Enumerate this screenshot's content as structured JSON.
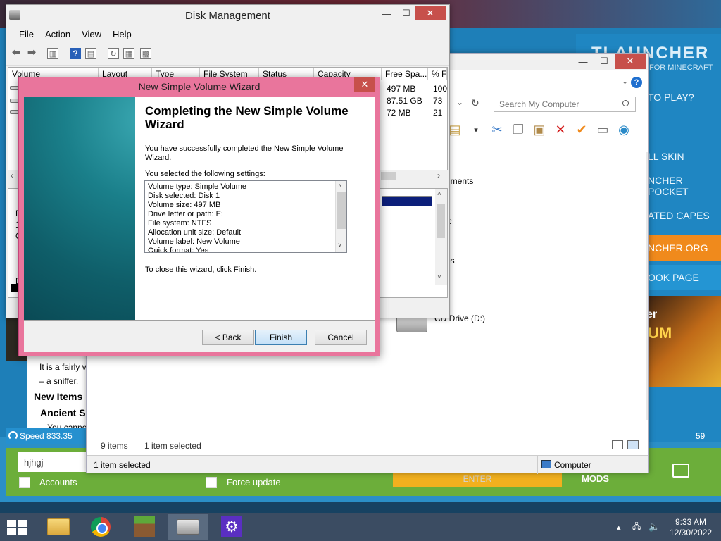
{
  "launcher": {
    "brand": "TLAUNCHER",
    "brand_sub": "FOR MINECRAFT",
    "menu_items": [
      "TO PLAY?",
      "",
      "LL SKIN",
      "NCHER POCKET",
      "ATED CAPES",
      "NCHER.ORG",
      "OOK PAGE"
    ],
    "promo_text": "UM",
    "promo_text_top": "er",
    "right_number": "59",
    "speed": "Speed 833.35",
    "nickname_value": "hjhgj",
    "accounts_label": "Accounts",
    "force_update_label": "Force update",
    "enter_button": "ENTER",
    "mods_logo": "MODS",
    "article": {
      "line1": "It is a fairly v",
      "line2": "– a sniffer.",
      "heading1": "New Items",
      "heading2": "Ancient Se",
      "line3": "- You cannot"
    }
  },
  "explorer": {
    "search_placeholder": "Search My Computer",
    "items": [
      {
        "label": "uments"
      },
      {
        "label": "ic"
      },
      {
        "label": "os"
      },
      {
        "label": "CD Drive (D:)"
      }
    ],
    "status_count": "9 items",
    "status_selected": "1 item selected",
    "bottom_selected": "1 item selected",
    "bottom_location": "Computer",
    "help_glyph": "?"
  },
  "disk_mgmt": {
    "title": "Disk Management",
    "menu": [
      "File",
      "Action",
      "View",
      "Help"
    ],
    "columns": [
      "Volume",
      "Layout",
      "Type",
      "File System",
      "Status",
      "Capacity",
      "Free Spa...",
      "% F"
    ],
    "rows": [
      {
        "free": "497 MB",
        "pct": "100"
      },
      {
        "free": "87.51 GB",
        "pct": "73"
      },
      {
        "free": "72 MB",
        "pct": "21"
      }
    ],
    "lower_labels": [
      "B",
      "1",
      "O"
    ],
    "lower_label2": "D"
  },
  "wizard": {
    "title": "New Simple Volume Wizard",
    "heading": "Completing the New Simple Volume Wizard",
    "success_text": "You have successfully completed the New Simple Volume Wizard.",
    "settings_intro": "You selected the following settings:",
    "settings": [
      "Volume type: Simple Volume",
      "Disk selected: Disk 1",
      "Volume size: 497 MB",
      "Drive letter or path: E:",
      "File system: NTFS",
      "Allocation unit size: Default",
      "Volume label: New Volume",
      "Quick format: Yes"
    ],
    "close_text": "To close this wizard, click Finish.",
    "back_button": "< Back",
    "finish_button": "Finish",
    "cancel_button": "Cancel"
  },
  "taskbar": {
    "time": "9:33 AM",
    "date": "12/30/2022"
  }
}
